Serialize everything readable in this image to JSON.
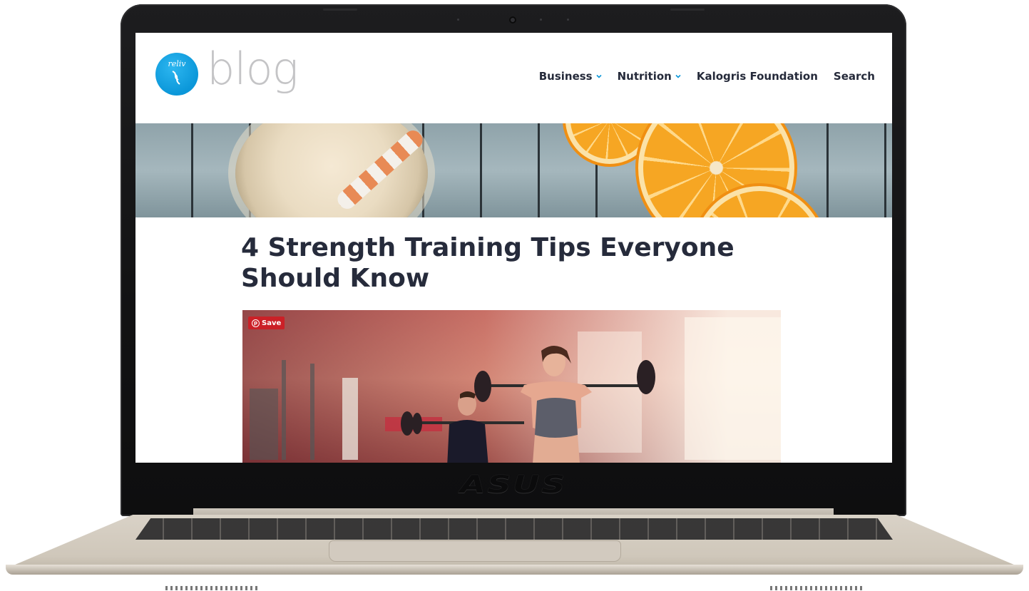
{
  "device": {
    "brand_label": "ASUS"
  },
  "site": {
    "logo_mark": "reliv",
    "logo_word": "blog"
  },
  "nav": {
    "items": [
      {
        "label": "Business",
        "has_dropdown": true
      },
      {
        "label": "Nutrition",
        "has_dropdown": true
      },
      {
        "label": "Kalogris Foundation",
        "has_dropdown": false
      },
      {
        "label": "Search",
        "has_dropdown": false
      }
    ]
  },
  "article": {
    "title": "4 Strength Training Tips Everyone Should Know",
    "image_save_label": "Save"
  },
  "colors": {
    "nav_text": "#252a3a",
    "accent_blue": "#0b97d9",
    "save_red": "#cb2027",
    "title_text": "#262b3b"
  }
}
